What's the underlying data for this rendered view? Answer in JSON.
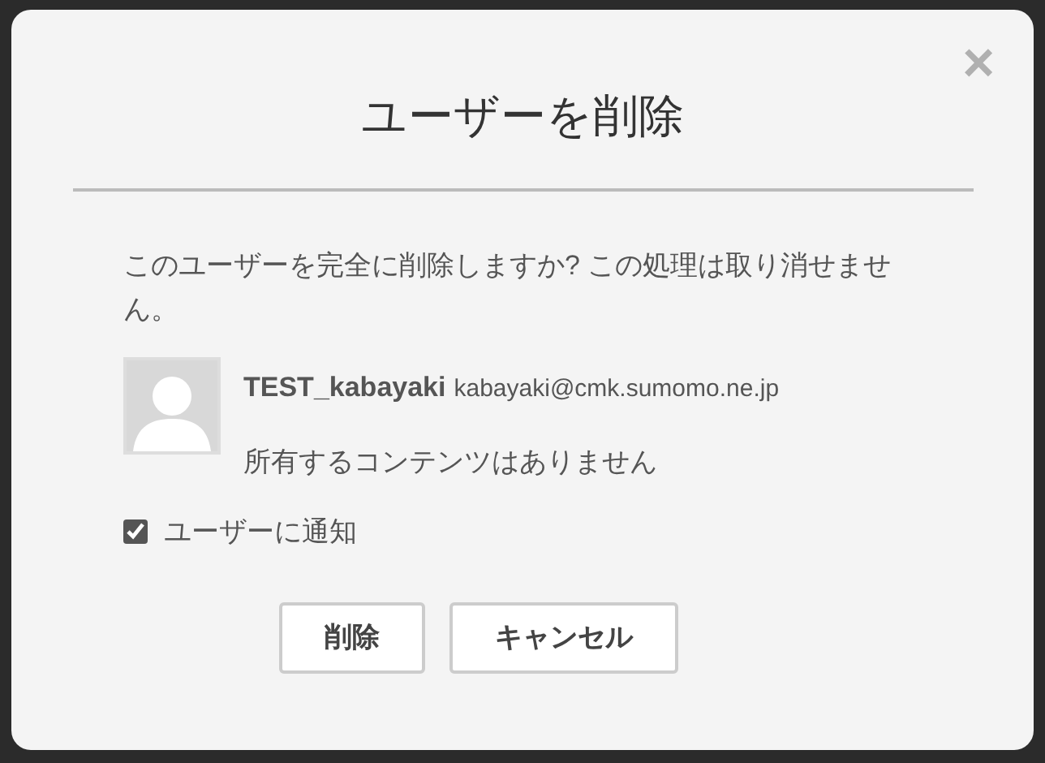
{
  "dialog": {
    "title": "ユーザーを削除",
    "close": "×",
    "message": "このユーザーを完全に削除しますか? この処理は取り消せません。",
    "user": {
      "name": "TEST_kabayaki",
      "email": "kabayaki@cmk.sumomo.ne.jp",
      "contents_note": "所有するコンテンツはありません"
    },
    "notify": {
      "label": "ユーザーに通知",
      "checked": true
    },
    "buttons": [
      {
        "label": "削除"
      },
      {
        "label": "キャンセル"
      }
    ]
  }
}
